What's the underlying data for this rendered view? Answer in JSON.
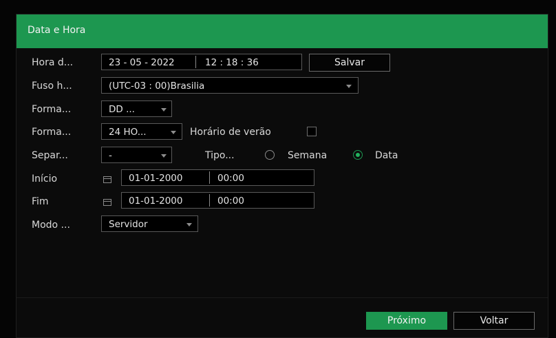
{
  "window": {
    "title": "Data e Hora"
  },
  "rows": {
    "system_time": {
      "label": "Hora d...",
      "date": "23 - 05 - 2022",
      "time": "12 : 18 : 36",
      "save_button": "Salvar"
    },
    "timezone": {
      "label": "Fuso h...",
      "value": "(UTC-03 : 00)Brasilia"
    },
    "date_format": {
      "label": "Forma...",
      "value": "DD ..."
    },
    "time_format": {
      "label": "Forma...",
      "value": "24 HO...",
      "dst_label": "Horário de verão",
      "dst_checked": false
    },
    "separator": {
      "label": "Separ...",
      "value": "-",
      "type_label": "Tipo...",
      "option_week": "Semana",
      "option_date": "Data",
      "selected": "Data"
    },
    "start": {
      "label": "Início",
      "date": "01-01-2000",
      "time": "00:00"
    },
    "end": {
      "label": "Fim",
      "date": "01-01-2000",
      "time": "00:00"
    },
    "mode": {
      "label": "Modo ...",
      "value": "Servidor"
    }
  },
  "footer": {
    "next_button": "Próximo",
    "back_button": "Voltar"
  },
  "colors": {
    "accent": "#1d9750",
    "background": "#0b0b0b"
  },
  "icons": [
    "caret-down-icon",
    "calendar-icon",
    "checkbox-icon",
    "radio-icon"
  ]
}
